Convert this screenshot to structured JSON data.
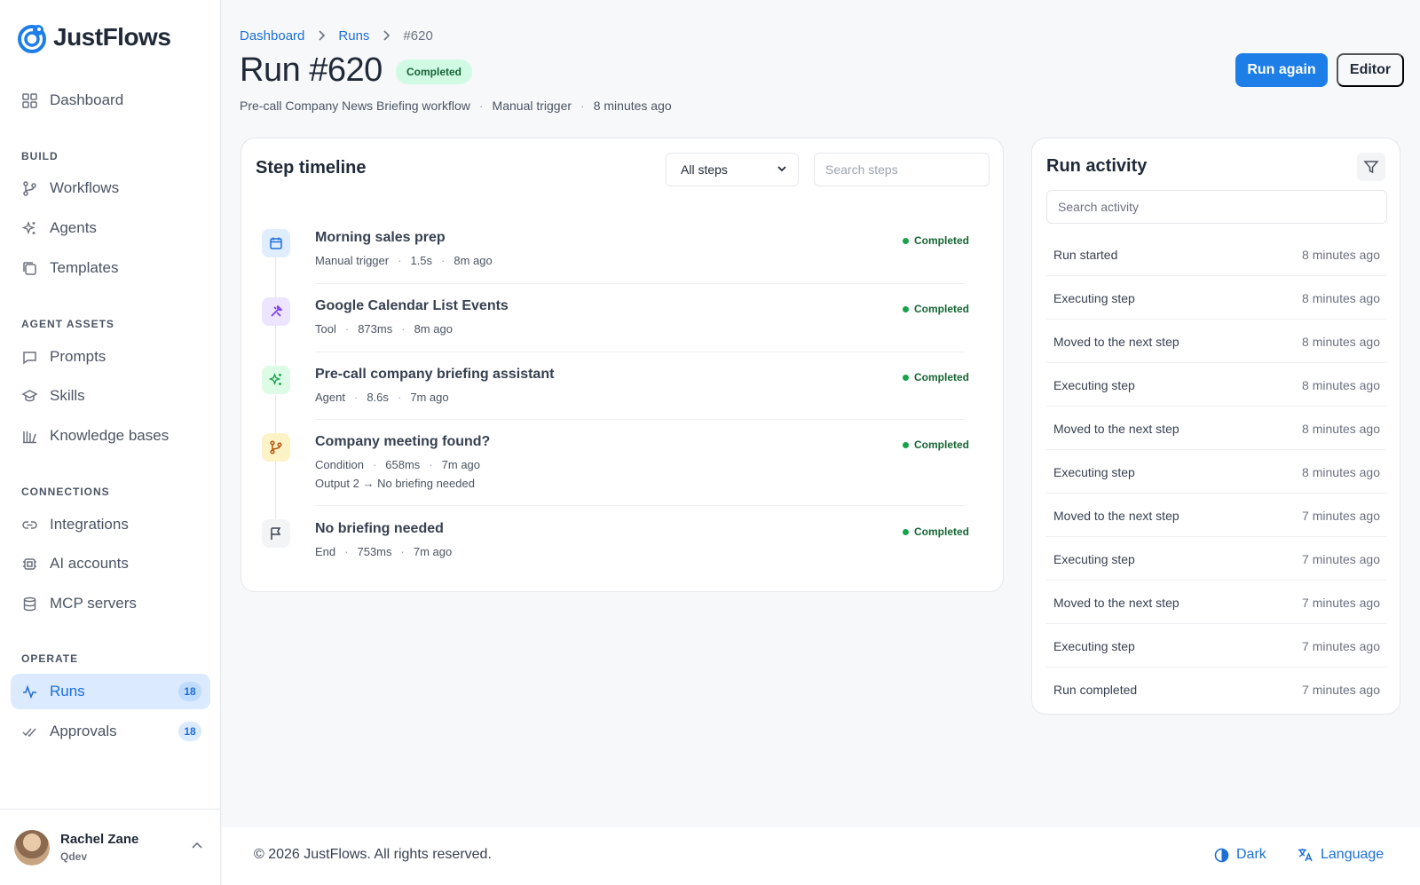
{
  "app": {
    "name": "JustFlows"
  },
  "sidebar": {
    "dashboard": "Dashboard",
    "sections": {
      "build": "BUILD",
      "agent_assets": "AGENT ASSETS",
      "connections": "CONNECTIONS",
      "operate": "OPERATE"
    },
    "items": {
      "workflows": "Workflows",
      "agents": "Agents",
      "templates": "Templates",
      "prompts": "Prompts",
      "skills": "Skills",
      "knowledge_bases": "Knowledge bases",
      "integrations": "Integrations",
      "ai_accounts": "AI accounts",
      "mcp_servers": "MCP servers",
      "runs": "Runs",
      "approvals": "Approvals"
    },
    "badges": {
      "runs": "18",
      "approvals": "18"
    },
    "user": {
      "name": "Rachel Zane",
      "org": "Qdev"
    }
  },
  "breadcrumb": {
    "dashboard": "Dashboard",
    "runs": "Runs",
    "current": "#620"
  },
  "header": {
    "title": "Run #620",
    "status": "Completed",
    "workflow": "Pre-call Company News Briefing workflow",
    "trigger": "Manual trigger",
    "time": "8 minutes ago",
    "run_again": "Run again",
    "editor": "Editor"
  },
  "timeline": {
    "title": "Step timeline",
    "filter_value": "All steps",
    "search_placeholder": "Search steps",
    "steps": [
      {
        "title": "Morning sales prep",
        "type": "Manual trigger",
        "duration": "1.5s",
        "ago": "8m ago",
        "status": "Completed"
      },
      {
        "title": "Google Calendar List Events",
        "type": "Tool",
        "duration": "873ms",
        "ago": "8m ago",
        "status": "Completed"
      },
      {
        "title": "Pre-call company briefing assistant",
        "type": "Agent",
        "duration": "8.6s",
        "ago": "7m ago",
        "status": "Completed"
      },
      {
        "title": "Company meeting found?",
        "type": "Condition",
        "duration": "658ms",
        "ago": "7m ago",
        "status": "Completed",
        "extra": "Output 2 → No briefing needed"
      },
      {
        "title": "No briefing needed",
        "type": "End",
        "duration": "753ms",
        "ago": "7m ago",
        "status": "Completed"
      }
    ]
  },
  "activity": {
    "title": "Run activity",
    "search_placeholder": "Search activity",
    "rows": [
      {
        "label": "Run started",
        "time": "8 minutes ago"
      },
      {
        "label": "Executing step",
        "time": "8 minutes ago"
      },
      {
        "label": "Moved to the next step",
        "time": "8 minutes ago"
      },
      {
        "label": "Executing step",
        "time": "8 minutes ago"
      },
      {
        "label": "Moved to the next step",
        "time": "8 minutes ago"
      },
      {
        "label": "Executing step",
        "time": "8 minutes ago"
      },
      {
        "label": "Moved to the next step",
        "time": "7 minutes ago"
      },
      {
        "label": "Executing step",
        "time": "7 minutes ago"
      },
      {
        "label": "Moved to the next step",
        "time": "7 minutes ago"
      },
      {
        "label": "Executing step",
        "time": "7 minutes ago"
      },
      {
        "label": "Run completed",
        "time": "7 minutes ago"
      }
    ]
  },
  "footer": {
    "copyright": "© 2026 JustFlows. All rights reserved.",
    "dark": "Dark",
    "language": "Language"
  },
  "colors": {
    "accent": "#1d7ee8",
    "success": "#16a34a",
    "active_bg": "#dbeafe"
  }
}
